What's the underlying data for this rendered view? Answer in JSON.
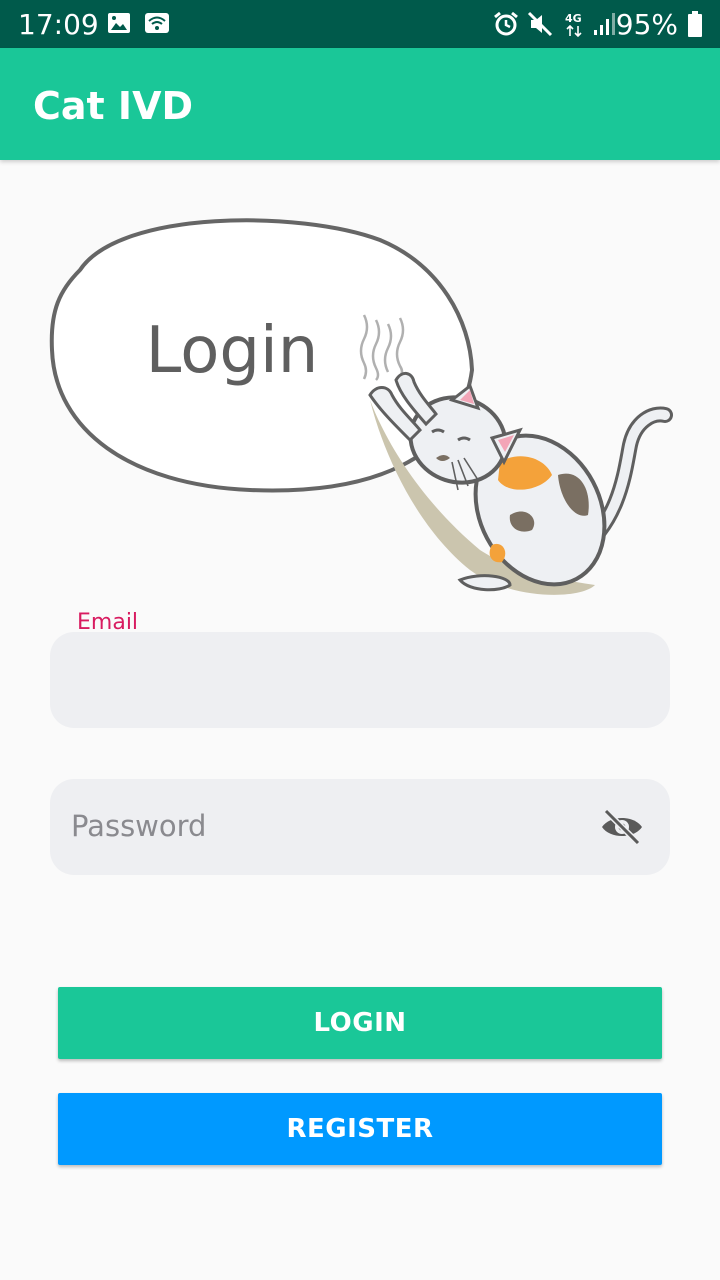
{
  "status_bar": {
    "time": "17:09",
    "battery": "95%",
    "network": "4G",
    "icons": [
      "image-icon",
      "wifi-icon",
      "alarm-icon",
      "mute-icon",
      "network-4g-icon",
      "signal-icon",
      "battery-icon"
    ]
  },
  "app_bar": {
    "title": "Cat IVD",
    "color": "#1ac798"
  },
  "illustration": {
    "bubble_text": "Login"
  },
  "form": {
    "email": {
      "label": "Email",
      "value": ""
    },
    "password": {
      "placeholder": "Password",
      "value": "",
      "toggle_icon": "eye-off-icon"
    }
  },
  "buttons": {
    "login_label": "LOGIN",
    "register_label": "REGISTER",
    "login_color": "#1ac798",
    "register_color": "#0099ff"
  }
}
